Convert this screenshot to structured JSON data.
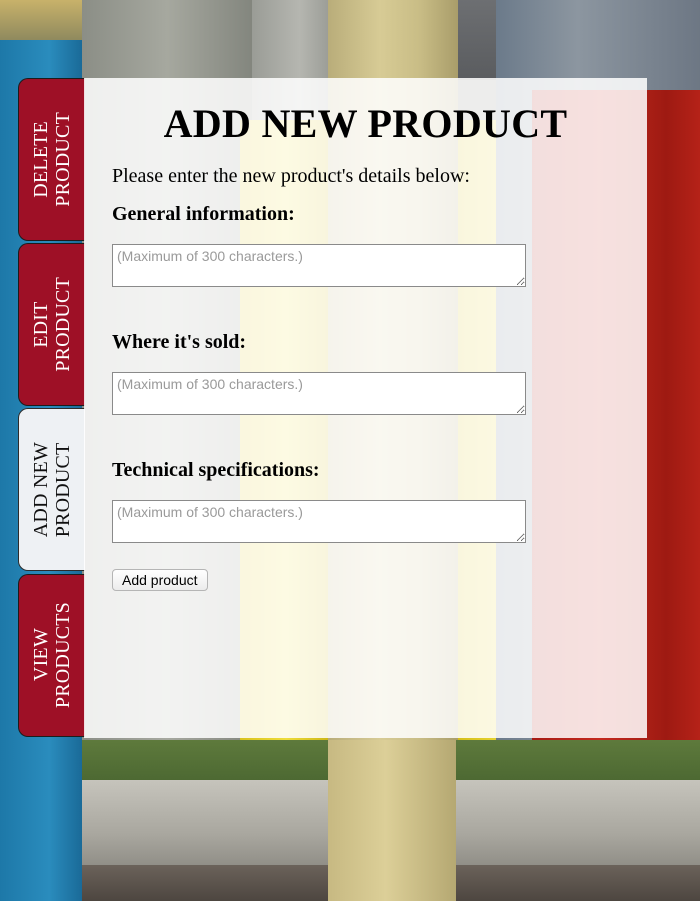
{
  "tabs": [
    {
      "label": "DELETE\nPRODUCT"
    },
    {
      "label": "EDIT\nPRODUCT"
    },
    {
      "label": "ADD NEW\nPRODUCT"
    },
    {
      "label": "VIEW\nPRODUCTS"
    }
  ],
  "main": {
    "title": "ADD NEW PRODUCT",
    "intro": "Please enter the new product's details below:",
    "fields": [
      {
        "label": "General information:",
        "value": "",
        "placeholder": "(Maximum of 300 characters.)"
      },
      {
        "label": "Where it's sold:",
        "value": "",
        "placeholder": "(Maximum of 300 characters.)"
      },
      {
        "label": "Technical specifications:",
        "value": "",
        "placeholder": "(Maximum of 300 characters.)"
      }
    ],
    "submit_label": "Add product"
  },
  "colors": {
    "tab_inactive": "#9e1026",
    "tab_active": "#eef1f4"
  }
}
